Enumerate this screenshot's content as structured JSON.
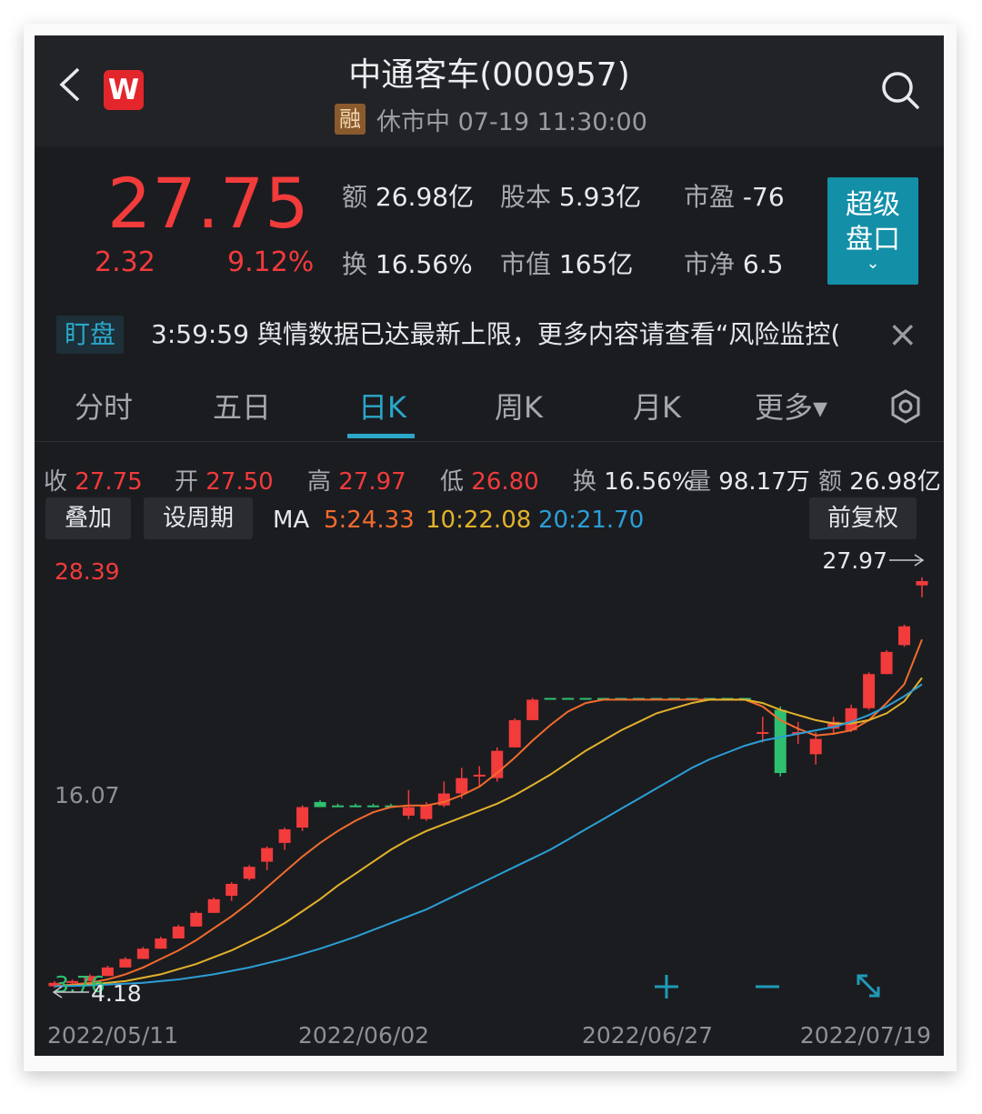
{
  "header": {
    "title": "中通客车(000957)",
    "badge": "融",
    "status": "休市中 07-19 11:30:00",
    "logo_letter": "W"
  },
  "quote": {
    "price": "27.75",
    "change": "2.32",
    "change_pct": "9.12%",
    "stats": [
      {
        "label": "额",
        "value": "26.98亿"
      },
      {
        "label": "股本",
        "value": "5.93亿"
      },
      {
        "label": "市盈",
        "value": "-76"
      },
      {
        "label": "换",
        "value": "16.56%"
      },
      {
        "label": "市值",
        "value": "165亿"
      },
      {
        "label": "市净",
        "value": "6.5"
      }
    ],
    "super_button": {
      "line1": "超级",
      "line2": "盘口",
      "chevron": "⌄"
    }
  },
  "ticker": {
    "tag": "盯盘",
    "text": "3:59:59 舆情数据已达最新上限，更多内容请查看“风险监控(",
    "close_glyph": "×"
  },
  "tabs": [
    {
      "label": "分时",
      "active": false
    },
    {
      "label": "五日",
      "active": false
    },
    {
      "label": "日K",
      "active": true
    },
    {
      "label": "周K",
      "active": false
    },
    {
      "label": "月K",
      "active": false
    },
    {
      "label": "更多▾",
      "active": false
    }
  ],
  "ohlc": {
    "close_label": "收",
    "close": "27.75",
    "open_label": "开",
    "open": "27.50",
    "high_label": "高",
    "high": "27.97",
    "low_label": "低",
    "low": "26.80",
    "turnover_label": "换",
    "turnover": "16.56%",
    "volume_label": "量",
    "volume": "98.17万",
    "amount_label": "额",
    "amount": "26.98亿"
  },
  "controls": {
    "overlay": "叠加",
    "period": "设周期",
    "adjust": "前复权",
    "ma_label": "MA",
    "ma5": "5:24.33",
    "ma10": "10:22.08",
    "ma20": "20:21.70"
  },
  "colors": {
    "up": "#f23b3b",
    "down": "#2fbf71",
    "accent": "#2aa7c9",
    "ma5": "#f26b2e",
    "ma10": "#e3b22b",
    "ma20": "#2b9fd6",
    "background": "#1b1c20"
  },
  "icons": {
    "back": "chevron-left-icon",
    "search": "search-icon",
    "settings": "settings-icon",
    "zoom_in": "plus-icon",
    "zoom_out": "minus-icon",
    "fullscreen": "expand-icon"
  },
  "chart_data": {
    "type": "candlestick",
    "axis_top": "28.39",
    "axis_mid": "16.07",
    "axis_bottom": "3.76",
    "ylim": [
      3.76,
      28.39
    ],
    "max_label": "27.97",
    "min_label": "4.18",
    "x_labels": [
      "2022/05/11",
      "2022/06/02",
      "2022/06/27",
      "2022/07/19"
    ],
    "candles": [
      {
        "o": 4.0,
        "c": 4.2,
        "h": 4.3,
        "l": 3.9
      },
      {
        "o": 4.2,
        "c": 4.3,
        "h": 4.4,
        "l": 4.1
      },
      {
        "o": 4.3,
        "c": 4.6,
        "h": 4.7,
        "l": 4.3
      },
      {
        "o": 4.6,
        "c": 5.1,
        "h": 5.2,
        "l": 4.6
      },
      {
        "o": 5.1,
        "c": 5.6,
        "h": 5.7,
        "l": 5.1
      },
      {
        "o": 5.6,
        "c": 6.2,
        "h": 6.3,
        "l": 5.6
      },
      {
        "o": 6.2,
        "c": 6.8,
        "h": 6.9,
        "l": 6.2
      },
      {
        "o": 6.8,
        "c": 7.5,
        "h": 7.6,
        "l": 6.8
      },
      {
        "o": 7.5,
        "c": 8.3,
        "h": 8.4,
        "l": 7.5
      },
      {
        "o": 8.3,
        "c": 9.1,
        "h": 9.2,
        "l": 8.3
      },
      {
        "o": 9.3,
        "c": 10.0,
        "h": 10.1,
        "l": 9.0
      },
      {
        "o": 10.3,
        "c": 11.0,
        "h": 11.1,
        "l": 10.2
      },
      {
        "o": 11.3,
        "c": 12.1,
        "h": 12.2,
        "l": 10.8
      },
      {
        "o": 12.4,
        "c": 13.2,
        "h": 13.3,
        "l": 12.0
      },
      {
        "o": 13.3,
        "c": 14.5,
        "h": 14.6,
        "l": 13.1
      },
      {
        "o": 14.8,
        "c": 14.5,
        "h": 14.9,
        "l": 14.5
      },
      {
        "o": 14.6,
        "c": 14.5,
        "h": 14.7,
        "l": 14.5
      },
      {
        "o": 14.6,
        "c": 14.5,
        "h": 14.7,
        "l": 14.5
      },
      {
        "o": 14.6,
        "c": 14.5,
        "h": 14.7,
        "l": 14.5
      },
      {
        "o": 14.6,
        "c": 14.5,
        "h": 14.7,
        "l": 14.5
      },
      {
        "o": 14.0,
        "c": 14.5,
        "h": 15.5,
        "l": 13.8
      },
      {
        "o": 13.8,
        "c": 14.6,
        "h": 14.8,
        "l": 13.7
      },
      {
        "o": 14.6,
        "c": 15.3,
        "h": 16.0,
        "l": 14.5
      },
      {
        "o": 15.3,
        "c": 16.2,
        "h": 16.8,
        "l": 15.0
      },
      {
        "o": 16.3,
        "c": 16.4,
        "h": 16.9,
        "l": 15.7
      },
      {
        "o": 16.2,
        "c": 17.8,
        "h": 18.0,
        "l": 16.0
      },
      {
        "o": 18.0,
        "c": 19.6,
        "h": 19.7,
        "l": 18.0
      },
      {
        "o": 19.6,
        "c": 20.8,
        "h": 20.9,
        "l": 19.6
      },
      {
        "o": 20.9,
        "c": 20.8,
        "h": 20.9,
        "l": 20.8
      },
      {
        "o": 20.9,
        "c": 20.8,
        "h": 20.9,
        "l": 20.8
      },
      {
        "o": 20.9,
        "c": 20.8,
        "h": 20.9,
        "l": 20.8
      },
      {
        "o": 20.9,
        "c": 20.8,
        "h": 20.9,
        "l": 20.8
      },
      {
        "o": 20.9,
        "c": 20.8,
        "h": 20.9,
        "l": 20.8
      },
      {
        "o": 20.9,
        "c": 20.8,
        "h": 20.9,
        "l": 20.8
      },
      {
        "o": 20.9,
        "c": 20.8,
        "h": 20.9,
        "l": 20.8
      },
      {
        "o": 20.9,
        "c": 20.8,
        "h": 20.9,
        "l": 20.8
      },
      {
        "o": 20.9,
        "c": 20.8,
        "h": 20.9,
        "l": 20.8
      },
      {
        "o": 20.9,
        "c": 20.8,
        "h": 20.9,
        "l": 20.8
      },
      {
        "o": 20.9,
        "c": 20.8,
        "h": 20.9,
        "l": 20.8
      },
      {
        "o": 20.9,
        "c": 20.8,
        "h": 20.9,
        "l": 20.8
      },
      {
        "o": 18.8,
        "c": 18.9,
        "h": 19.8,
        "l": 18.3
      },
      {
        "o": 20.2,
        "c": 16.5,
        "h": 20.4,
        "l": 16.3
      },
      {
        "o": 18.8,
        "c": 18.9,
        "h": 19.5,
        "l": 18.2
      },
      {
        "o": 17.6,
        "c": 18.5,
        "h": 18.9,
        "l": 17.0
      },
      {
        "o": 19.1,
        "c": 19.5,
        "h": 19.8,
        "l": 18.8
      },
      {
        "o": 19.0,
        "c": 20.3,
        "h": 20.5,
        "l": 18.9
      },
      {
        "o": 20.3,
        "c": 22.3,
        "h": 22.4,
        "l": 20.2
      },
      {
        "o": 22.3,
        "c": 23.6,
        "h": 23.7,
        "l": 22.3
      },
      {
        "o": 24.0,
        "c": 25.1,
        "h": 25.2,
        "l": 23.9
      },
      {
        "o": 27.5,
        "c": 27.75,
        "h": 27.97,
        "l": 26.8
      }
    ],
    "ma5": [
      4.0,
      4.1,
      4.2,
      4.4,
      4.7,
      5.1,
      5.6,
      6.1,
      6.7,
      7.4,
      8.1,
      8.9,
      9.8,
      10.7,
      11.6,
      12.4,
      13.1,
      13.7,
      14.2,
      14.5,
      14.6,
      14.6,
      14.8,
      15.2,
      15.7,
      16.5,
      17.4,
      18.4,
      19.3,
      20.1,
      20.6,
      20.8,
      20.8,
      20.8,
      20.8,
      20.8,
      20.8,
      20.8,
      20.8,
      20.8,
      20.4,
      19.6,
      19.1,
      18.7,
      18.8,
      19.0,
      19.6,
      20.6,
      21.7,
      24.33
    ],
    "ma10": [
      4.0,
      4.05,
      4.1,
      4.2,
      4.3,
      4.5,
      4.7,
      5.0,
      5.3,
      5.7,
      6.1,
      6.6,
      7.1,
      7.7,
      8.4,
      9.1,
      9.9,
      10.6,
      11.3,
      12.0,
      12.6,
      13.1,
      13.5,
      13.9,
      14.3,
      14.7,
      15.2,
      15.8,
      16.4,
      17.1,
      17.8,
      18.4,
      19.0,
      19.5,
      20.0,
      20.3,
      20.6,
      20.8,
      20.8,
      20.8,
      20.6,
      20.2,
      19.9,
      19.6,
      19.4,
      19.4,
      19.6,
      20.0,
      20.7,
      22.08
    ],
    "ma20": [
      4.0,
      4.02,
      4.05,
      4.1,
      4.15,
      4.2,
      4.3,
      4.4,
      4.55,
      4.7,
      4.9,
      5.1,
      5.35,
      5.6,
      5.9,
      6.2,
      6.55,
      6.9,
      7.3,
      7.7,
      8.1,
      8.5,
      9.0,
      9.5,
      10.0,
      10.5,
      11.0,
      11.5,
      12.0,
      12.6,
      13.2,
      13.8,
      14.4,
      15.0,
      15.6,
      16.2,
      16.8,
      17.3,
      17.7,
      18.1,
      18.4,
      18.6,
      18.8,
      19.0,
      19.2,
      19.5,
      19.9,
      20.4,
      21.0,
      21.7
    ]
  }
}
